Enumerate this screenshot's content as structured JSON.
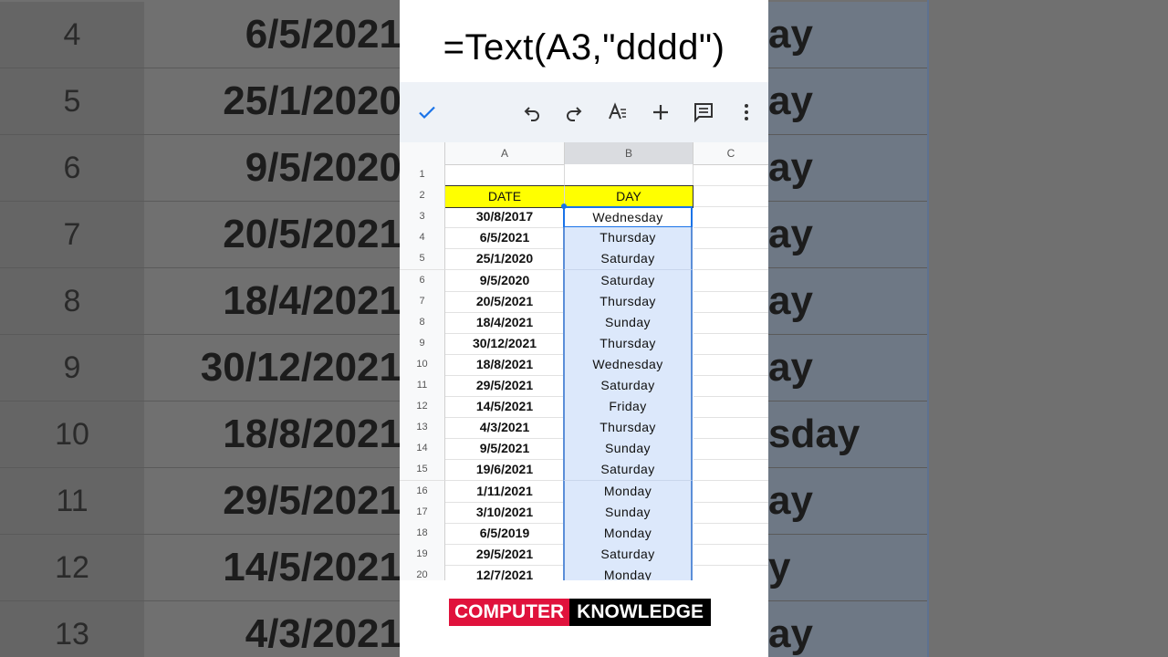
{
  "background": {
    "rows": [
      {
        "num": "4",
        "left": "6/5/2021",
        "right": "ay"
      },
      {
        "num": "5",
        "left": "25/1/2020",
        "right": "ay"
      },
      {
        "num": "6",
        "left": "9/5/2020",
        "right": "ay"
      },
      {
        "num": "7",
        "left": "20/5/2021",
        "right": "ay"
      },
      {
        "num": "8",
        "left": "18/4/2021",
        "right": "ay"
      },
      {
        "num": "9",
        "left": "30/12/2021",
        "right": "ay"
      },
      {
        "num": "10",
        "left": "18/8/2021",
        "right": "sday"
      },
      {
        "num": "11",
        "left": "29/5/2021",
        "right": "ay"
      },
      {
        "num": "12",
        "left": "14/5/2021",
        "right": "y"
      },
      {
        "num": "13",
        "left": "4/3/2021",
        "right": "ay"
      }
    ]
  },
  "title": "=Text(A3,\"dddd\")",
  "toolbar": {
    "icons": [
      "check-icon",
      "undo-icon",
      "redo-icon",
      "text-format-icon",
      "add-icon",
      "comment-icon",
      "more-vert-icon"
    ],
    "accent": "#1a73e8"
  },
  "grid": {
    "columns": [
      "A",
      "B",
      "C"
    ],
    "rows": [
      {
        "num": "1",
        "a": "",
        "b": ""
      },
      {
        "num": "2",
        "a": "DATE",
        "b": "DAY"
      },
      {
        "num": "3",
        "a": "30/8/2017",
        "b": "Wednesday"
      },
      {
        "num": "4",
        "a": "6/5/2021",
        "b": "Thursday"
      },
      {
        "num": "5",
        "a": "25/1/2020",
        "b": "Saturday"
      },
      {
        "num": "6",
        "a": "9/5/2020",
        "b": "Saturday"
      },
      {
        "num": "7",
        "a": "20/5/2021",
        "b": "Thursday"
      },
      {
        "num": "8",
        "a": "18/4/2021",
        "b": "Sunday"
      },
      {
        "num": "9",
        "a": "30/12/2021",
        "b": "Thursday"
      },
      {
        "num": "10",
        "a": "18/8/2021",
        "b": "Wednesday"
      },
      {
        "num": "11",
        "a": "29/5/2021",
        "b": "Saturday"
      },
      {
        "num": "12",
        "a": "14/5/2021",
        "b": "Friday"
      },
      {
        "num": "13",
        "a": "4/3/2021",
        "b": "Thursday"
      },
      {
        "num": "14",
        "a": "9/5/2021",
        "b": "Sunday"
      },
      {
        "num": "15",
        "a": "19/6/2021",
        "b": "Saturday"
      },
      {
        "num": "16",
        "a": "1/11/2021",
        "b": "Monday"
      },
      {
        "num": "17",
        "a": "3/10/2021",
        "b": "Sunday"
      },
      {
        "num": "18",
        "a": "6/5/2019",
        "b": "Monday"
      },
      {
        "num": "19",
        "a": "29/5/2021",
        "b": "Saturday"
      },
      {
        "num": "20",
        "a": "12/7/2021",
        "b": "Monday"
      }
    ],
    "header_color": "#ffff00",
    "selection_color": "#dce8fb"
  },
  "branding": {
    "part1": "COMPUTER",
    "part2": "KNOWLEDGE"
  }
}
